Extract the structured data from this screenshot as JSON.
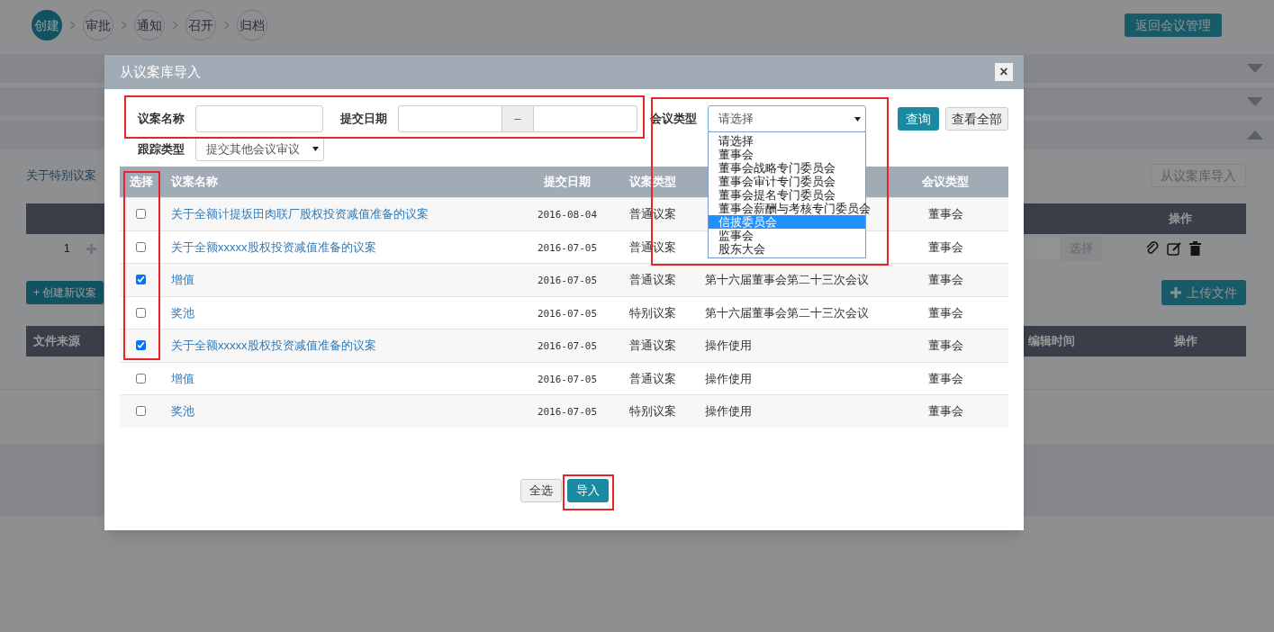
{
  "steps": [
    {
      "label": "创建",
      "selected": true
    },
    {
      "label": "审批",
      "selected": false
    },
    {
      "label": "通知",
      "selected": false
    },
    {
      "label": "召开",
      "selected": false
    },
    {
      "label": "归档",
      "selected": false
    }
  ],
  "back_button": "返回会议管理",
  "panels": [
    {
      "expanded": false
    },
    {
      "expanded": false
    },
    {
      "expanded": true
    }
  ],
  "section": {
    "link": "关于特别议案",
    "import_button": "从议案库导入",
    "columns": [
      "操作"
    ],
    "row": {
      "index": "1",
      "file_button": "选择"
    }
  },
  "create_button": "+ 创建新议案",
  "upload_button": "上传文件",
  "files_table": {
    "columns": [
      "文件来源",
      "编辑时间",
      "操作"
    ]
  },
  "modal": {
    "title": "从议案库导入",
    "close": "×",
    "filters": {
      "name_label": "议案名称",
      "date_label": "提交日期",
      "date_separator": "–",
      "meeting_type_label": "会议类型",
      "meeting_type_value": "请选择",
      "query_button": "查询",
      "all_button": "查看全部",
      "track_label": "跟踪类型",
      "track_value": "提交其他会议审议"
    },
    "dropdown": [
      {
        "label": "请选择",
        "selected": false
      },
      {
        "label": "董事会",
        "selected": false
      },
      {
        "label": "董事会战略专门委员会",
        "selected": false
      },
      {
        "label": "董事会审计专门委员会",
        "selected": false
      },
      {
        "label": "董事会提名专门委员会",
        "selected": false
      },
      {
        "label": "董事会薪酬与考核专门委员会",
        "selected": false
      },
      {
        "label": "信披委员会",
        "selected": true
      },
      {
        "label": "监事会",
        "selected": false
      },
      {
        "label": "股东大会",
        "selected": false
      }
    ],
    "columns": [
      "选择",
      "议案名称",
      "提交日期",
      "议案类型",
      null,
      "会议类型"
    ],
    "rows": [
      {
        "checked": false,
        "name": "关于全额计提坂田肉联厂股权投资减值准备的议案",
        "date": "2016-08-04",
        "type": "普通议案",
        "meeting_type": "董事会"
      },
      {
        "checked": false,
        "name": "关于全额xxxxx股权投资减值准备的议案",
        "date": "2016-07-05",
        "type": "普通议案",
        "meeting_type": "董事会"
      },
      {
        "checked": true,
        "name": "增值",
        "date": "2016-07-05",
        "type": "普通议案",
        "meeting": "第十六届董事会第二十三次会议",
        "meeting_type": "董事会"
      },
      {
        "checked": false,
        "name": "奖池",
        "date": "2016-07-05",
        "type": "特别议案",
        "meeting": "第十六届董事会第二十三次会议",
        "meeting_type": "董事会"
      },
      {
        "checked": true,
        "name": "关于全额xxxxx股权投资减值准备的议案",
        "date": "2016-07-05",
        "type": "普通议案",
        "meeting": "操作使用",
        "meeting_type": "董事会"
      },
      {
        "checked": false,
        "name": "增值",
        "date": "2016-07-05",
        "type": "普通议案",
        "meeting": "操作使用",
        "meeting_type": "董事会"
      },
      {
        "checked": false,
        "name": "奖池",
        "date": "2016-07-05",
        "type": "特别议案",
        "meeting": "操作使用",
        "meeting_type": "董事会"
      }
    ],
    "footer_buttons": [
      {
        "label": "全选",
        "kind": "default"
      },
      {
        "label": "导入",
        "kind": "primary"
      }
    ]
  }
}
